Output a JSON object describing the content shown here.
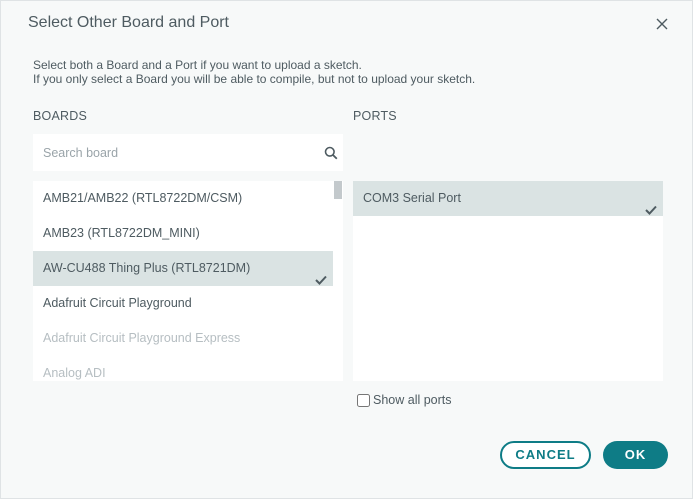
{
  "dialog": {
    "title": "Select Other Board and Port",
    "description_line1": "Select both a Board and a Port if you want to upload a sketch.",
    "description_line2": "If you only select a Board you will be able to compile, but not to upload your sketch."
  },
  "boards": {
    "label": "BOARDS",
    "search_placeholder": "Search board",
    "search_value": "",
    "items": [
      {
        "label": "AMB21/AMB22 (RTL8722DM/CSM)",
        "selected": false
      },
      {
        "label": "AMB23 (RTL8722DM_MINI)",
        "selected": false
      },
      {
        "label": "AW-CU488 Thing Plus (RTL8721DM)",
        "selected": true
      },
      {
        "label": "Adafruit Circuit Playground",
        "selected": false
      },
      {
        "label": "Adafruit Circuit Playground Express",
        "selected": false
      },
      {
        "label": "Analog ADI",
        "selected": false
      }
    ]
  },
  "ports": {
    "label": "PORTS",
    "items": [
      {
        "label": "COM3 Serial Port",
        "selected": true
      }
    ],
    "show_all_label": "Show all ports",
    "show_all_checked": false
  },
  "actions": {
    "cancel_label": "CANCEL",
    "ok_label": "OK"
  },
  "colors": {
    "accent": "#0e7c86",
    "selected_row": "#dae3e3",
    "text": "#4e5b61"
  },
  "icons": {
    "close": "close-icon",
    "search": "search-icon",
    "check": "checkmark-icon"
  }
}
